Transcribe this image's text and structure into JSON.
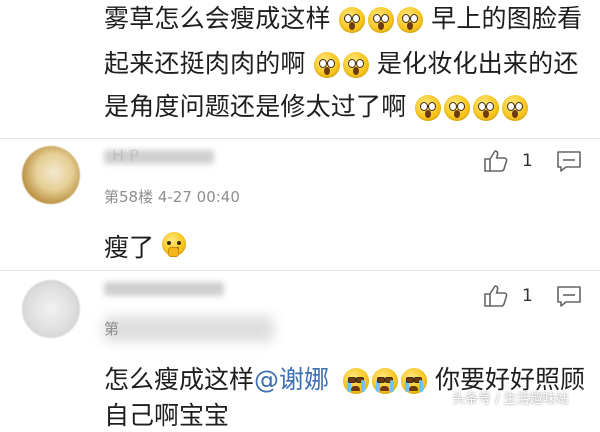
{
  "post": {
    "line1": "雾草怎么会瘦成这样",
    "line1_after": "早上的图脸看",
    "line2": "起来还挺肉肉的啊",
    "line2_after": "是化妆化出来的还",
    "line3": "是角度问题还是修太过了啊"
  },
  "comment1": {
    "name_partial": "H  P",
    "floor_meta": "第58楼  4-27 00:40",
    "like_count": "1",
    "text": "瘦了"
  },
  "comment2": {
    "floor_partial": "第",
    "like_count": "1",
    "text_before": "怎么瘦成这样",
    "mention": "@谢娜",
    "text_after": "你要好好照顾",
    "line2": "自己啊宝宝"
  },
  "watermark": "头条号 / 生活趣味站",
  "icons": {
    "like": "thumbs-up-icon",
    "reply": "comment-bubble-icon",
    "shocked": "shocked-emoji-icon",
    "crying": "crying-emoji-icon",
    "thinking": "thinking-emoji-icon"
  },
  "colors": {
    "mention": "#3d6fb4",
    "meta": "#8e8e8e",
    "divider": "#e4e4e4"
  }
}
